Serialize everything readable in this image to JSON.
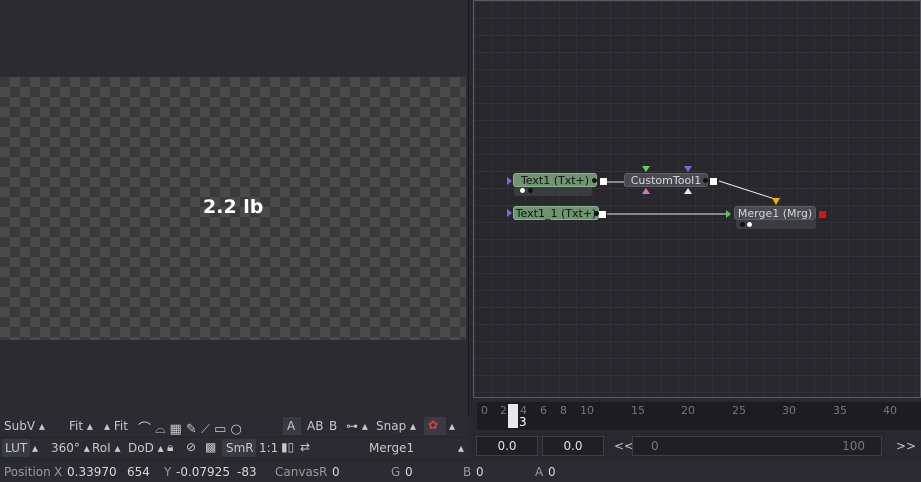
{
  "viewer": {
    "resolution": "1920x1080xint",
    "overlay_text": "2.2 lb"
  },
  "flow": {
    "nodes": {
      "text1": "Text1  (Txt+)",
      "custom": "CustomTool1",
      "text1_1": "Text1_1  (Txt+)",
      "merge": "Merge1  (Mrg)"
    }
  },
  "toolbar_top": {
    "subv": "SubV",
    "fit1": "Fit",
    "fit2": "Fit",
    "a_label": "A",
    "b_label": "B",
    "snap": "Snap"
  },
  "toolbar_bottom": {
    "lut": "LUT",
    "angle": "360°",
    "roi": "RoI",
    "dod": "DoD",
    "smr": "SmR",
    "ratio": "1:1",
    "view_name": "Merge1"
  },
  "timeline": {
    "ticks": [
      "0",
      "2",
      "4",
      "6",
      "8",
      "10",
      "15",
      "20",
      "25",
      "30",
      "35",
      "40"
    ],
    "current_frame": "3",
    "field1": "0.0",
    "field2": "0.0",
    "nav_prev": "<<",
    "nav_next": ">>",
    "range_start": "0",
    "range_end": "100"
  },
  "status": {
    "position_label": "Position",
    "x_label": "X",
    "x_value": "0.33970",
    "x_px": "654",
    "y_label": "Y",
    "y_value": "-0.07925",
    "y_px": "-83",
    "canvas_label": "Canvas",
    "r_label": "R",
    "r_value": "0",
    "g_label": "G",
    "g_value": "0",
    "b_label": "B",
    "b_value": "0",
    "a_label": "A",
    "a_value": "0"
  },
  "colors": {
    "accent_green": "#6f9470",
    "output_red": "#d01818",
    "yellow_arrow": "#f0b400",
    "pink_arrow": "#e070c0"
  }
}
